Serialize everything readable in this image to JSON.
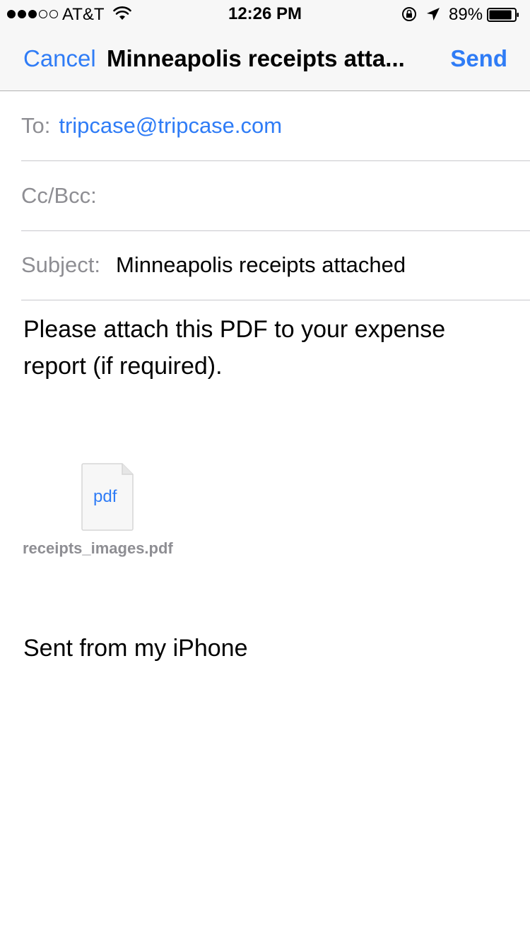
{
  "status_bar": {
    "carrier": "AT&T",
    "signal_bars_filled": 3,
    "signal_bars_total": 5,
    "time": "12:26 PM",
    "battery_percent": "89%",
    "battery_level": 0.89
  },
  "nav": {
    "cancel_label": "Cancel",
    "title": "Minneapolis receipts atta...",
    "send_label": "Send",
    "accent_color": "#2f7cf6"
  },
  "compose": {
    "to_label": "To:",
    "to_value": "tripcase@tripcase.com",
    "cc_label": "Cc/Bcc:",
    "subject_label": "Subject:",
    "subject_value": "Minneapolis receipts attached"
  },
  "body": {
    "text": "Please attach this PDF to your expense report (if required).",
    "signature": "Sent from my iPhone"
  },
  "attachment": {
    "type_label": "pdf",
    "filename": "receipts_images.pdf",
    "icon": "pdf-file-icon"
  }
}
